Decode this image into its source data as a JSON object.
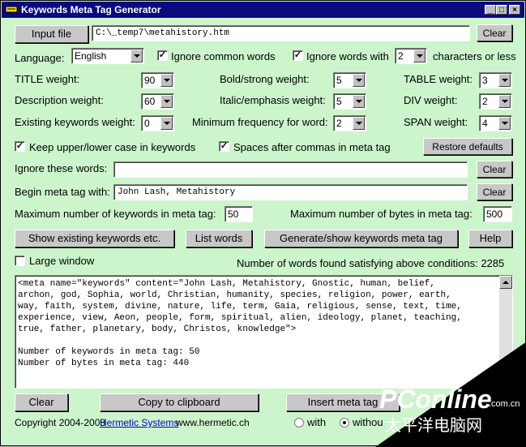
{
  "window": {
    "title": "Keywords Meta Tag Generator"
  },
  "input": {
    "button": "Input file",
    "path": "C:\\_temp7\\metahistory.htm",
    "clear": "Clear"
  },
  "language": {
    "label": "Language:",
    "value": "English"
  },
  "ignore_common": {
    "label": "Ignore common words",
    "checked": true
  },
  "ignore_with": {
    "label": "Ignore words with",
    "value": "2",
    "suffix": "characters or less",
    "checked": true
  },
  "weights": {
    "title": {
      "label": "TITLE weight:",
      "value": "90"
    },
    "bold": {
      "label": "Bold/strong weight:",
      "value": "5"
    },
    "table": {
      "label": "TABLE weight:",
      "value": "3"
    },
    "desc": {
      "label": "Description weight:",
      "value": "60"
    },
    "italic": {
      "label": "Italic/emphasis weight:",
      "value": "5"
    },
    "div": {
      "label": "DIV weight:",
      "value": "2"
    },
    "existing": {
      "label": "Existing keywords weight:",
      "value": "0"
    },
    "minfreq": {
      "label": "Minimum frequency for word:",
      "value": "2"
    },
    "span": {
      "label": "SPAN weight:",
      "value": "4"
    }
  },
  "keep_case": {
    "label": "Keep upper/lower case in keywords",
    "checked": true
  },
  "spaces_after": {
    "label": "Spaces after commas in meta tag",
    "checked": true
  },
  "restore": "Restore defaults",
  "ignore_words": {
    "label": "Ignore these words:",
    "value": "",
    "clear": "Clear"
  },
  "begin_tag": {
    "label": "Begin meta tag with:",
    "value": "John Lash, Metahistory",
    "clear": "Clear"
  },
  "max_keywords": {
    "label": "Maximum number of keywords in meta tag:",
    "value": "50"
  },
  "max_bytes": {
    "label": "Maximum number of bytes in meta tag:",
    "value": "500"
  },
  "actions": {
    "show_existing": "Show existing  keywords etc.",
    "list_words": "List words",
    "generate": "Generate/show keywords meta tag",
    "help": "Help"
  },
  "large_window": {
    "label": "Large window",
    "checked": false
  },
  "words_found": "Number of words found satisfying above conditions: 2285",
  "output": "<meta name=\"keywords\" content=\"John Lash, Metahistory, Gnostic, human, belief,\narchon, god, Sophia, world, Christian, humanity, species, religion, power, earth,\nway, faith, system, divine, nature, life, term, Gaia, religious, sense, text, time,\nexperience, view, Aeon, people, form, spiritual, alien, ideology, planet, teaching,\ntrue, father, planetary, body, Christos, knowledge\">\n\nNumber of keywords in meta tag: 50\nNumber of bytes in meta tag: 440",
  "bottom": {
    "clear": "Clear",
    "copy": "Copy to clipboard",
    "insert": "Insert meta tag",
    "with": "with",
    "without": "withou"
  },
  "footer": {
    "copyright": "Copyright 2004-2008",
    "company": "Hermetic Systems",
    "url": "www.hermetic.ch"
  },
  "watermark": {
    "brand": "PConline",
    "domain": ".com.cn",
    "chinese": "太平洋电脑网"
  }
}
